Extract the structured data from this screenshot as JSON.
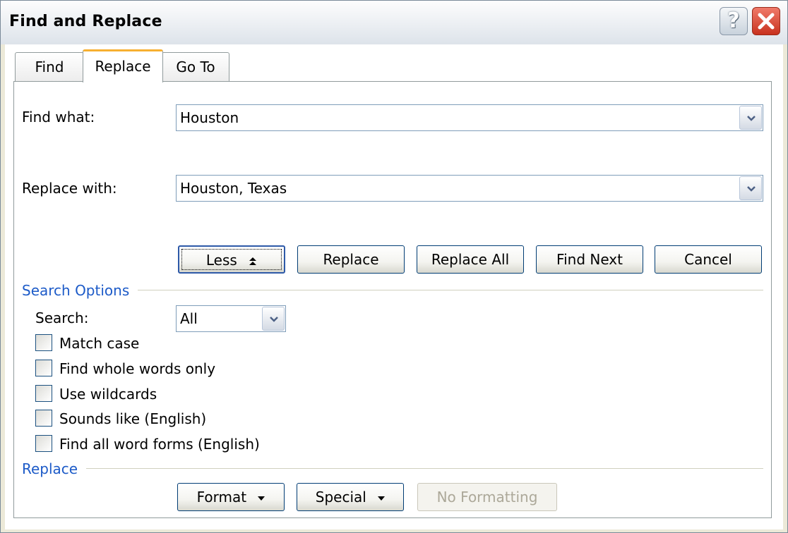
{
  "window": {
    "title": "Find and Replace",
    "help_symbol": "?"
  },
  "tabs": [
    {
      "label": "Find",
      "selected": false
    },
    {
      "label": "Replace",
      "selected": true
    },
    {
      "label": "Go To",
      "selected": false
    }
  ],
  "find": {
    "label": "Find what:",
    "value": "Houston"
  },
  "replace": {
    "label": "Replace with:",
    "value": "Houston, Texas"
  },
  "buttons": {
    "less": "Less",
    "replace": "Replace",
    "replace_all": "Replace All",
    "find_next": "Find Next",
    "cancel": "Cancel"
  },
  "search_options": {
    "header": "Search Options",
    "search_label": "Search:",
    "search_value": "All",
    "checkboxes": [
      {
        "label": "Match case",
        "checked": false
      },
      {
        "label": "Find whole words only",
        "checked": false
      },
      {
        "label": "Use wildcards",
        "checked": false
      },
      {
        "label": "Sounds like (English)",
        "checked": false
      },
      {
        "label": "Find all word forms (English)",
        "checked": false
      }
    ]
  },
  "replace_section": {
    "header": "Replace",
    "format": "Format",
    "special": "Special",
    "no_formatting": "No Formatting"
  },
  "colors": {
    "accent": "#1d5bc8",
    "tab_highlight": "#f7b031",
    "close_red": "#c8321e"
  }
}
